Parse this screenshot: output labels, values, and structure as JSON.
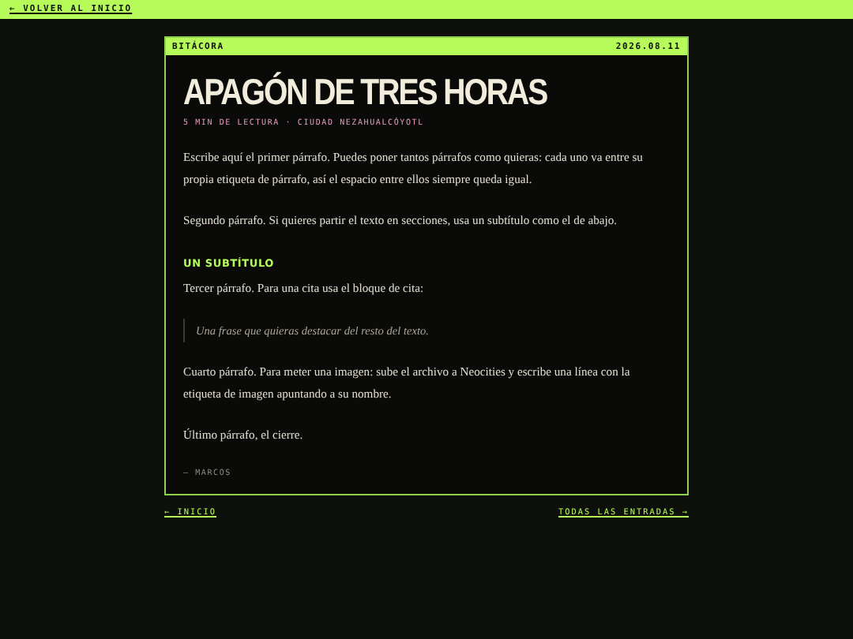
{
  "top_bar": {
    "back_link": "← VOLVER AL INICIO"
  },
  "card": {
    "label": "BITÁCORA",
    "date": "2026.08.11",
    "title": "APAGÓN DE TRES HORAS",
    "meta": "5 MIN DE LECTURA · CIUDAD NEZAHUALCÓYOTL",
    "blocks": [
      {
        "kind": "paragraph",
        "text": "Escribe aquí el primer párrafo. Puedes poner tantos párrafos como quieras: cada uno va entre su propia etiqueta de párrafo, así el espacio entre ellos siempre queda igual."
      },
      {
        "kind": "paragraph",
        "text": "Segundo párrafo. Si quieres partir el texto en secciones, usa un subtítulo como el de abajo."
      },
      {
        "kind": "subtitle",
        "text": "UN SUBTÍTULO"
      },
      {
        "kind": "paragraph",
        "text": "Tercer párrafo. Para una cita usa el bloque de cita:"
      },
      {
        "kind": "quote",
        "text": "Una frase que quieras destacar del resto del texto."
      },
      {
        "kind": "paragraph",
        "text": "Cuarto párrafo. Para meter una imagen: sube el archivo a Neocities y escribe una línea con la etiqueta de imagen apuntando a su nombre."
      },
      {
        "kind": "paragraph",
        "text": "Último párrafo, el cierre."
      },
      {
        "kind": "signature",
        "text": "— MARCOS"
      }
    ]
  },
  "footer_nav": {
    "previous": "← INICIO",
    "next": "TODAS LAS ENTRADAS →"
  }
}
